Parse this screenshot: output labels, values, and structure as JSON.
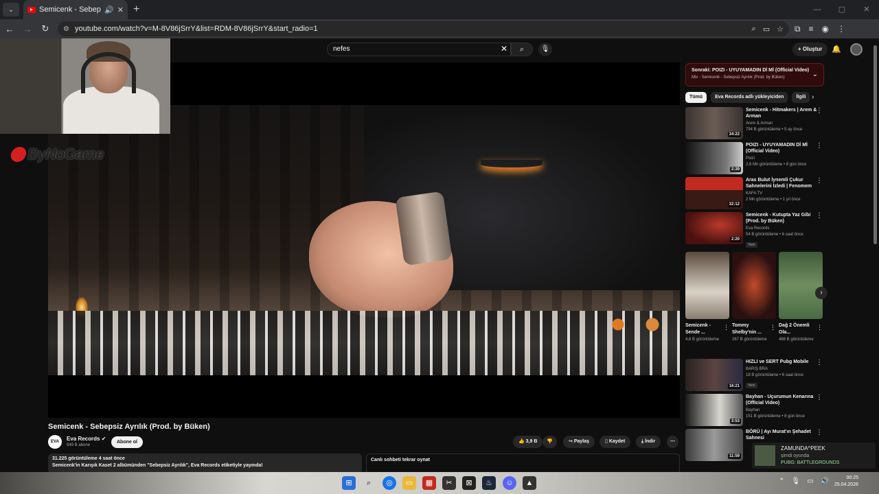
{
  "browser": {
    "tab_title": "Semicenk - Sebepsiz Ayrılık",
    "url": "youtube.com/watch?v=M-8V86jSrrY&list=RDM-8V86jSrrY&start_radio=1"
  },
  "header": {
    "search_value": "nefes",
    "create_label": "Oluştur"
  },
  "overlay": {
    "brand_text": "ByNoGame"
  },
  "video": {
    "title": "Semicenk - Sebepsiz Ayrılık (Prod. by Büken)",
    "channel": "Eva Records",
    "channel_initials": "EVA",
    "subscribers": "949 B abone",
    "subscribe_label": "Abone ol",
    "likes": "3,9 B",
    "share_label": "Paylaş",
    "save_label": "Kaydet",
    "download_label": "İndir",
    "description_stats": "31.225 görüntüleme  4 saat önce",
    "description_text": "Semicenk'in Karışık Kaset 2 albümünden \"Sebepsiz Ayrılık\", Eva Records etiketiyle yayında!",
    "chat_label": "Canlı sohbeti tekrar oynat"
  },
  "sidebar": {
    "next_title": "Sonraki: POIZI - UYUYAMADIN Dİ Mİ (Official Video)",
    "next_sub": "Mix - Semicenk - Sebepsiz Ayrılık (Prod. by Büken)",
    "chips": [
      "Tümü",
      "Eva Records adlı yükleyiciden",
      "İlgili"
    ],
    "recs": [
      {
        "title": "Semicenk - Hitmakers | Arem & Arman",
        "channel": "Arem & Arman",
        "meta": "794 B görüntüleme • 5 ay önce",
        "duration": "34:22",
        "badge": ""
      },
      {
        "title": "POIZI - UYUYAMADIN Dİ Mİ (Official Video)",
        "channel": "Poizi",
        "meta": "2,6 Mn görüntüleme • 8 gün önce",
        "duration": "2:39",
        "badge": ""
      },
      {
        "title": "Aras Bulut İynemli Çukur Sahnelerini İzledi | Fenomem",
        "channel": "KAFA TV",
        "meta": "2 Mn görüntüleme • 1 yıl önce",
        "duration": "32:12",
        "badge": ""
      },
      {
        "title": "Semicenk - Kutupta Yaz Gibi (Prod. by Büken)",
        "channel": "Eva Records",
        "meta": "54 B görüntüleme • 6 saat önce",
        "duration": "2:20",
        "badge": "Yeni"
      }
    ],
    "shorts": [
      {
        "title": "Semicenk - Sende ...",
        "views": "4,6 B görüntüleme"
      },
      {
        "title": "Tommy Shelby'nin ...",
        "views": "267 B görüntüleme"
      },
      {
        "title": "Dağ 2 Önemli Ola...",
        "views": "488 B görüntüleme"
      }
    ],
    "recs2": [
      {
        "title": "HIZLI ve SERT Pubg Mobile",
        "channel": "BARIŞ BRA",
        "meta": "18 B görüntüleme • 6 saat önce",
        "duration": "16:21",
        "badge": "Yeni"
      },
      {
        "title": "Bayhan - Uçurumun Kenarına (Official Video)",
        "channel": "Bayhan",
        "meta": "151 B görüntüleme • 8 gün önce",
        "duration": "3:53",
        "badge": ""
      },
      {
        "title": "BÖRÜ | Ayı Murat'ın Şehadet Sahnesi",
        "channel": "",
        "meta": "",
        "duration": "11:59",
        "badge": ""
      }
    ]
  },
  "notification": {
    "name": "ZAMUNDA^PEEK",
    "status": "şimdi oyunda",
    "game": "PUBG: BATTLEGROUNDS"
  },
  "taskbar": {
    "time": "00:25",
    "date": "25.04.2026"
  },
  "colors": {
    "accent": "#ff0000",
    "next_bg": "#2f0b0b"
  }
}
